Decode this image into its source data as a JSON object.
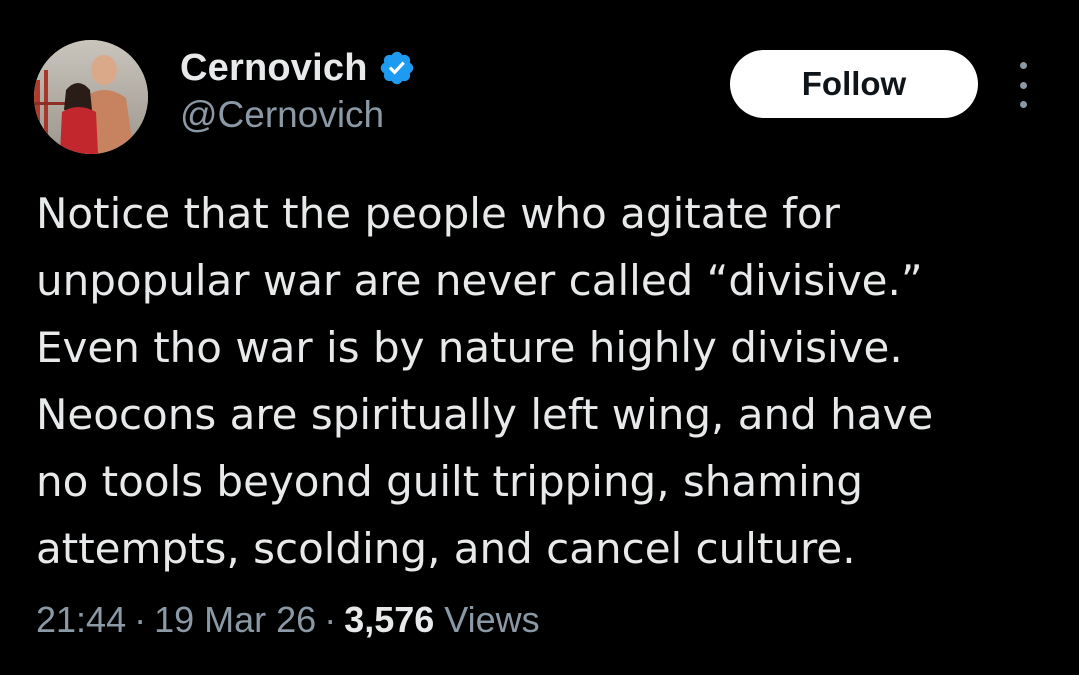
{
  "author": {
    "display_name": "Cernovich",
    "handle": "@Cernovich",
    "verified": true,
    "verified_color": "#1d9bf0",
    "avatar_icon": "profile-photo"
  },
  "actions": {
    "follow_label": "Follow",
    "more_icon": "more-options-icon"
  },
  "tweet": {
    "lines": [
      "Notice that the people who agitate for",
      "unpopular war are never called “divisive.”",
      "Even tho war is by nature highly divisive.",
      "Neocons are spiritually left wing, and have",
      "no tools beyond guilt tripping, shaming",
      "attempts, scolding, and cancel culture."
    ]
  },
  "meta": {
    "time": "21:44",
    "separator": "·",
    "date": "19 Mar 26",
    "views_count": "3,576",
    "views_label": "Views"
  },
  "colors": {
    "background": "#000000",
    "text_primary": "#e7e9ea",
    "text_secondary": "#8b98a5",
    "follow_bg": "#ffffff",
    "follow_text": "#0f1419"
  }
}
